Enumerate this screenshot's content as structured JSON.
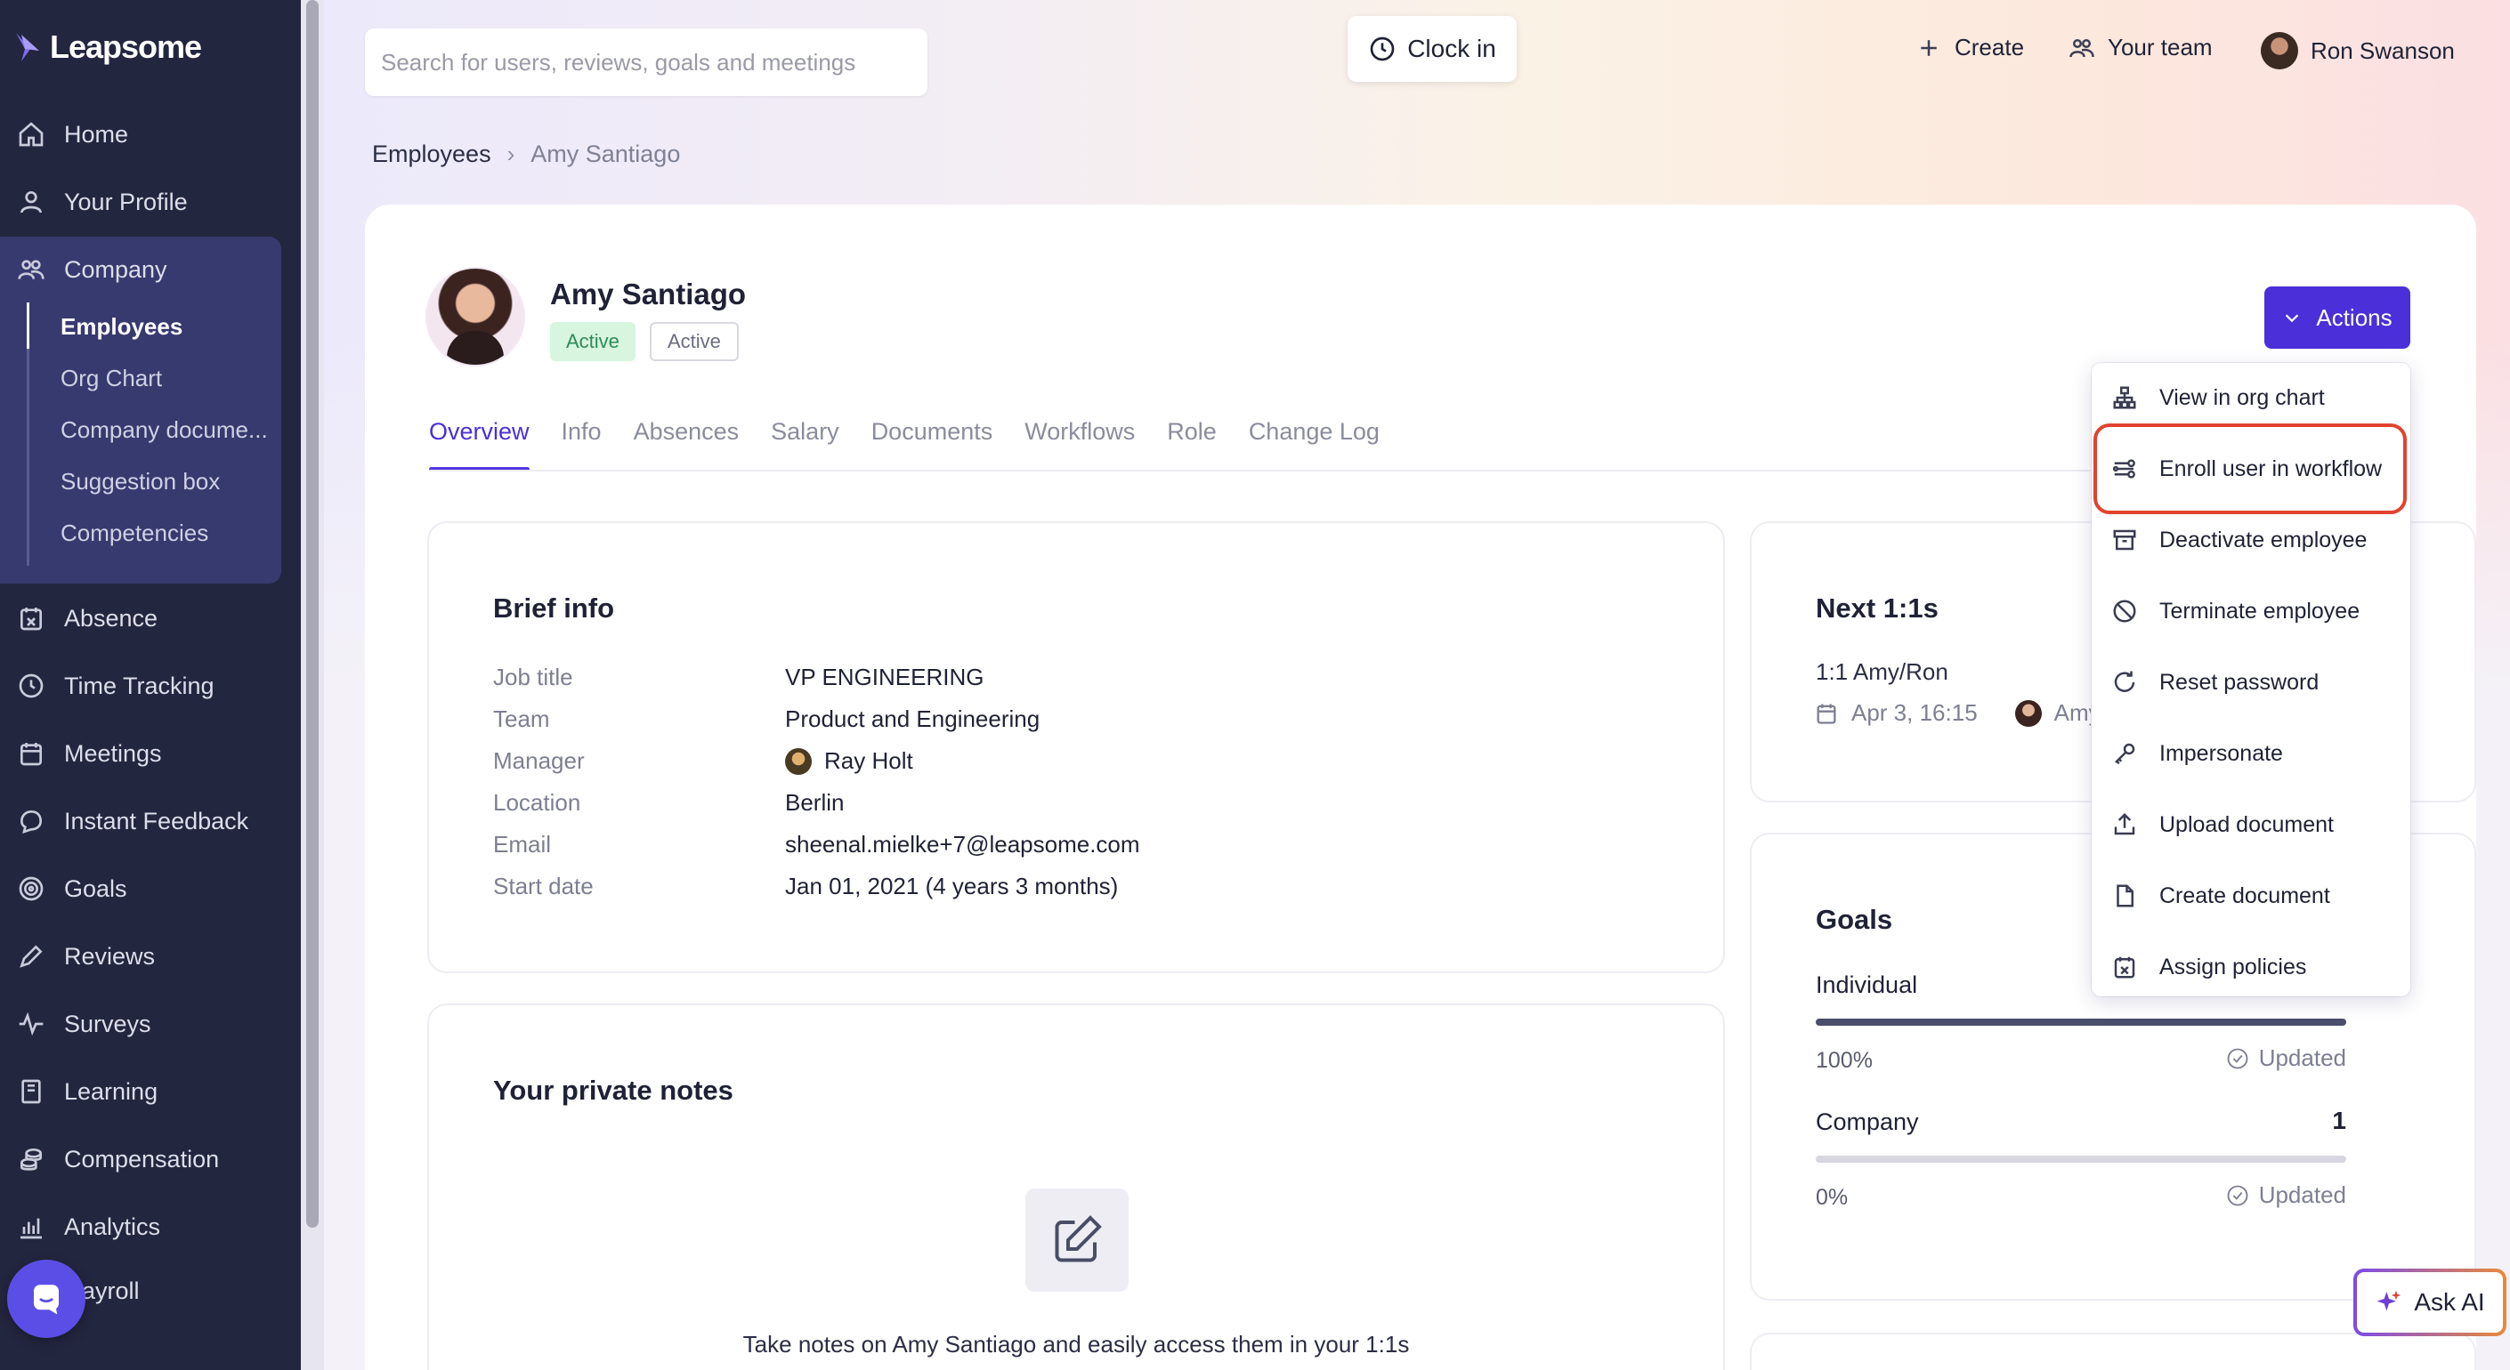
{
  "app": {
    "logo_text": "Leapsome"
  },
  "sidebar": {
    "items": [
      {
        "label": "Home",
        "icon": "home-icon"
      },
      {
        "label": "Your Profile",
        "icon": "user-icon"
      },
      {
        "label": "Company",
        "icon": "users-icon"
      },
      {
        "label": "Absence",
        "icon": "calendar-x-icon"
      },
      {
        "label": "Time Tracking",
        "icon": "clock-icon"
      },
      {
        "label": "Meetings",
        "icon": "calendar-icon"
      },
      {
        "label": "Instant Feedback",
        "icon": "chat-icon"
      },
      {
        "label": "Goals",
        "icon": "target-icon"
      },
      {
        "label": "Reviews",
        "icon": "pen-icon"
      },
      {
        "label": "Surveys",
        "icon": "pulse-icon"
      },
      {
        "label": "Learning",
        "icon": "book-icon"
      },
      {
        "label": "Compensation",
        "icon": "coins-icon"
      },
      {
        "label": "Analytics",
        "icon": "chart-icon"
      },
      {
        "label": "ayroll",
        "icon": ""
      }
    ],
    "company_sub": [
      "Employees",
      "Org Chart",
      "Company docume...",
      "Suggestion box",
      "Competencies"
    ]
  },
  "topbar": {
    "search_placeholder": "Search for users, reviews, goals and meetings",
    "clock_in": "Clock in",
    "create": "Create",
    "your_team": "Your team",
    "user_name": "Ron Swanson"
  },
  "breadcrumb": {
    "parent": "Employees",
    "current": "Amy Santiago"
  },
  "profile": {
    "name": "Amy Santiago",
    "badge_status": "Active",
    "badge_outline": "Active",
    "actions_label": "Actions"
  },
  "tabs": [
    "Overview",
    "Info",
    "Absences",
    "Salary",
    "Documents",
    "Workflows",
    "Role",
    "Change Log"
  ],
  "brief_info": {
    "title": "Brief info",
    "rows": [
      {
        "key": "Job title",
        "value": "VP ENGINEERING"
      },
      {
        "key": "Team",
        "value": "Product and Engineering"
      },
      {
        "key": "Manager",
        "value": "Ray Holt"
      },
      {
        "key": "Location",
        "value": "Berlin"
      },
      {
        "key": "Email",
        "value": "sheenal.mielke+7@leapsome.com"
      },
      {
        "key": "Start date",
        "value": "Jan 01, 2021 (4 years 3 months)"
      }
    ]
  },
  "notes": {
    "title": "Your private notes",
    "text": "Take notes on Amy Santiago and easily access them in your 1:1s"
  },
  "next_one_on_ones": {
    "title": "Next 1:1s",
    "meeting": "1:1 Amy/Ron",
    "date": "Apr 3, 16:15",
    "participant": "Amy"
  },
  "goals": {
    "title": "Goals",
    "individual": {
      "label": "Individual",
      "percent": "100%",
      "status": "Updated",
      "progress": 1.0
    },
    "company": {
      "label": "Company",
      "count": "1",
      "percent": "0%",
      "status": "Updated",
      "progress": 0.0
    }
  },
  "actions_menu": [
    {
      "label": "View in org chart",
      "icon": "org-chart-icon"
    },
    {
      "label": "Enroll user in workflow",
      "icon": "workflow-icon"
    },
    {
      "label": "Deactivate employee",
      "icon": "archive-icon"
    },
    {
      "label": "Terminate employee",
      "icon": "ban-icon"
    },
    {
      "label": "Reset password",
      "icon": "refresh-icon"
    },
    {
      "label": "Impersonate",
      "icon": "key-icon"
    },
    {
      "label": "Upload document",
      "icon": "upload-icon"
    },
    {
      "label": "Create document",
      "icon": "file-icon"
    },
    {
      "label": "Assign policies",
      "icon": "calendar-x-icon"
    }
  ],
  "ask_ai": "Ask AI",
  "colors": {
    "accent": "#4b2fd8",
    "sidebar": "#23263f",
    "highlight": "#e0432e",
    "success_bg": "#d7f5df"
  }
}
